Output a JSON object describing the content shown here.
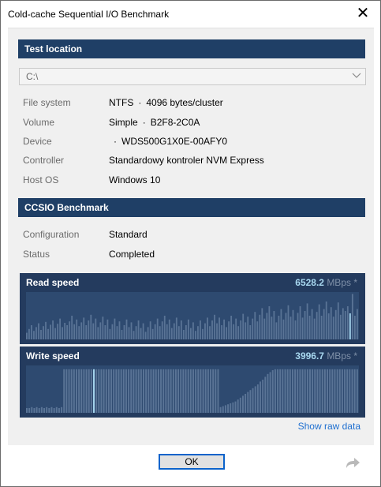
{
  "window": {
    "title": "Cold-cache Sequential I/O Benchmark",
    "close_glyph": "✕"
  },
  "test_location": {
    "heading": "Test location",
    "drive": "C:\\",
    "rows": [
      {
        "label": "File system",
        "value": "NTFS",
        "extra": "4096 bytes/cluster"
      },
      {
        "label": "Volume",
        "value": "Simple",
        "extra": "B2F8-2C0A"
      },
      {
        "label": "Device",
        "value": "",
        "extra": "WDS500G1X0E-00AFY0"
      },
      {
        "label": "Controller",
        "value": "Standardowy kontroler NVM Express"
      },
      {
        "label": "Host OS",
        "value": "Windows 10"
      }
    ],
    "separator": "·"
  },
  "benchmark": {
    "heading": "CCSIO Benchmark",
    "rows": [
      {
        "label": "Configuration",
        "value": "Standard"
      },
      {
        "label": "Status",
        "value": "Completed"
      }
    ]
  },
  "chart_data": [
    {
      "type": "bar",
      "title": "Read speed",
      "readout_value": "6528.2",
      "readout_unit": "MBps *",
      "highlight_color": "#a8d8f0",
      "bar_color": "#5a7496",
      "values": [
        0.14,
        0.22,
        0.3,
        0.18,
        0.26,
        0.34,
        0.2,
        0.28,
        0.37,
        0.22,
        0.31,
        0.4,
        0.24,
        0.33,
        0.44,
        0.26,
        0.35,
        0.3,
        0.38,
        0.5,
        0.32,
        0.42,
        0.28,
        0.36,
        0.46,
        0.3,
        0.4,
        0.52,
        0.34,
        0.44,
        0.26,
        0.36,
        0.48,
        0.3,
        0.42,
        0.22,
        0.32,
        0.44,
        0.28,
        0.38,
        0.2,
        0.3,
        0.42,
        0.26,
        0.36,
        0.18,
        0.28,
        0.4,
        0.24,
        0.34,
        0.16,
        0.26,
        0.38,
        0.22,
        0.32,
        0.44,
        0.28,
        0.38,
        0.5,
        0.32,
        0.42,
        0.24,
        0.34,
        0.46,
        0.28,
        0.4,
        0.2,
        0.3,
        0.42,
        0.24,
        0.36,
        0.18,
        0.28,
        0.4,
        0.22,
        0.34,
        0.46,
        0.28,
        0.4,
        0.52,
        0.34,
        0.46,
        0.3,
        0.42,
        0.26,
        0.38,
        0.5,
        0.32,
        0.44,
        0.28,
        0.4,
        0.54,
        0.36,
        0.48,
        0.3,
        0.44,
        0.58,
        0.38,
        0.52,
        0.66,
        0.44,
        0.56,
        0.7,
        0.48,
        0.6,
        0.36,
        0.5,
        0.64,
        0.42,
        0.56,
        0.72,
        0.48,
        0.62,
        0.4,
        0.56,
        0.7,
        0.46,
        0.6,
        0.76,
        0.5,
        0.64,
        0.44,
        0.58,
        0.74,
        0.5,
        0.64,
        0.8,
        0.55,
        0.68,
        0.48,
        0.62,
        0.78,
        0.52,
        0.66,
        0.6,
        0.7,
        0.55,
        0.96,
        0.5,
        0.64
      ],
      "highlight_index": 136,
      "ylim": [
        0,
        1
      ]
    },
    {
      "type": "bar",
      "title": "Write speed",
      "readout_value": "3996.7",
      "readout_unit": "MBps *",
      "highlight_color": "#a8d8f0",
      "bar_color": "#5a7496",
      "values": [
        0.1,
        0.1,
        0.12,
        0.1,
        0.12,
        0.1,
        0.12,
        0.1,
        0.12,
        0.1,
        0.12,
        0.1,
        0.12,
        0.1,
        0.12,
        0.92,
        0.92,
        0.92,
        0.92,
        0.92,
        0.92,
        0.92,
        0.92,
        0.92,
        0.92,
        0.92,
        0.92,
        0.92,
        0.92,
        0.92,
        0.92,
        0.92,
        0.92,
        0.92,
        0.92,
        0.92,
        0.92,
        0.92,
        0.92,
        0.92,
        0.92,
        0.92,
        0.92,
        0.92,
        0.92,
        0.92,
        0.92,
        0.92,
        0.92,
        0.92,
        0.92,
        0.92,
        0.92,
        0.92,
        0.92,
        0.92,
        0.92,
        0.92,
        0.92,
        0.92,
        0.92,
        0.92,
        0.92,
        0.92,
        0.92,
        0.92,
        0.92,
        0.92,
        0.92,
        0.92,
        0.92,
        0.92,
        0.92,
        0.92,
        0.92,
        0.92,
        0.92,
        0.92,
        0.12,
        0.14,
        0.16,
        0.18,
        0.2,
        0.22,
        0.24,
        0.28,
        0.32,
        0.36,
        0.4,
        0.44,
        0.48,
        0.52,
        0.56,
        0.6,
        0.66,
        0.7,
        0.76,
        0.82,
        0.86,
        0.9,
        0.92,
        0.92,
        0.92,
        0.92,
        0.92,
        0.92,
        0.92,
        0.92,
        0.92,
        0.92,
        0.92,
        0.92,
        0.92,
        0.92,
        0.92,
        0.92,
        0.92,
        0.92,
        0.92,
        0.92,
        0.92,
        0.92,
        0.92,
        0.92,
        0.92,
        0.92,
        0.92,
        0.92,
        0.92,
        0.92,
        0.92,
        0.92,
        0.92,
        0.92
      ],
      "highlight_index": 27,
      "ylim": [
        0,
        1
      ]
    }
  ],
  "footer": {
    "show_raw_data": "Show raw data",
    "ok_label": "OK",
    "share_icon": "share-arrow-icon"
  }
}
